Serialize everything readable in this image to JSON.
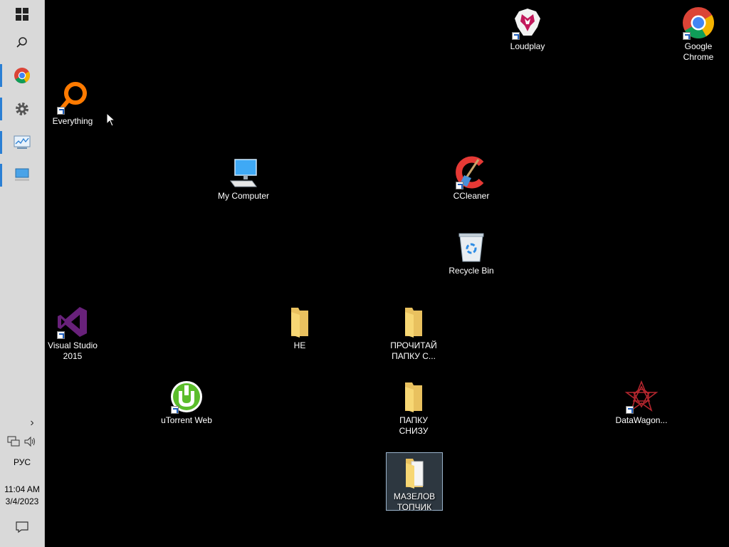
{
  "taskbar": {
    "language": "РУС",
    "time": "11:04 AM",
    "date": "3/4/2023",
    "show_hidden_icon": "chevron-right-icon",
    "accent": "#2a7fd4"
  },
  "desktop": {
    "icons": [
      {
        "label": "Loudplay",
        "icon": "loudplay-icon"
      },
      {
        "label": "Google\nChrome",
        "icon": "chrome-icon"
      },
      {
        "label": "Everything",
        "icon": "everything-icon"
      },
      {
        "label": "My Computer",
        "icon": "computer-icon"
      },
      {
        "label": "CCleaner",
        "icon": "ccleaner-icon"
      },
      {
        "label": "Recycle Bin",
        "icon": "recycle-bin-icon"
      },
      {
        "label": "Visual Studio\n2015",
        "icon": "visual-studio-icon"
      },
      {
        "label": "НЕ",
        "icon": "folder-icon"
      },
      {
        "label": "ПРОЧИТАЙ\nПАПКУ С...",
        "icon": "folder-icon"
      },
      {
        "label": "uTorrent Web",
        "icon": "utorrent-icon"
      },
      {
        "label": "ПАПКУ\nСНИЗУ",
        "icon": "folder-icon"
      },
      {
        "label": "DataWagon...",
        "icon": "datawagon-icon"
      },
      {
        "label": "МАЗЕЛОВ\nТОПЧИК",
        "icon": "folder-with-document-icon",
        "selected": true
      }
    ]
  }
}
